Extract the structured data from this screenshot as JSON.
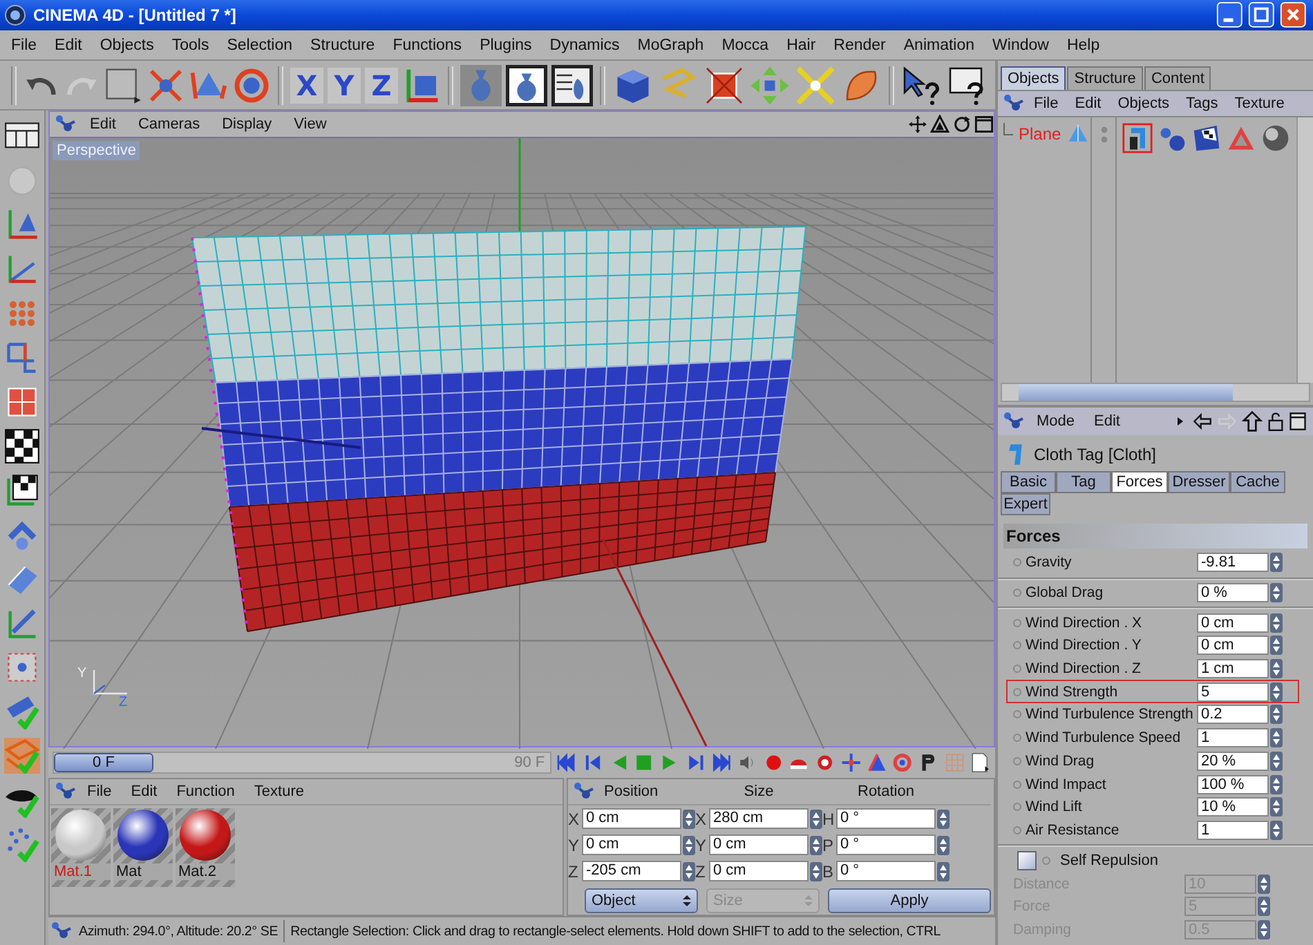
{
  "window": {
    "title": "CINEMA 4D - [Untitled 7 *]"
  },
  "menu_bar": [
    "File",
    "Edit",
    "Objects",
    "Tools",
    "Selection",
    "Structure",
    "Functions",
    "Plugins",
    "Dynamics",
    "MoGraph",
    "Mocca",
    "Hair",
    "Render",
    "Animation",
    "Window",
    "Help"
  ],
  "toolbar": {
    "axis_buttons": [
      "X",
      "Y",
      "Z"
    ]
  },
  "viewport": {
    "menu": [
      "Edit",
      "Cameras",
      "Display",
      "View"
    ],
    "camera_label": "Perspective",
    "axis_labels": [
      "Y",
      "Z"
    ]
  },
  "timeline": {
    "current_frame": "0 F",
    "end_frame": "90 F"
  },
  "material_manager": {
    "menu": [
      "File",
      "Edit",
      "Function",
      "Texture"
    ],
    "materials": [
      {
        "name": "Mat.1",
        "color": "#c8c8c8",
        "selected": true
      },
      {
        "name": "Mat",
        "color": "#2a35b8",
        "selected": false
      },
      {
        "name": "Mat.2",
        "color": "#c41818",
        "selected": false
      }
    ]
  },
  "coordinates": {
    "columns": [
      "Position",
      "Size",
      "Rotation"
    ],
    "rows": [
      {
        "cells": [
          {
            "axis": "X",
            "value": "0 cm"
          },
          {
            "axis": "X",
            "value": "280 cm"
          },
          {
            "axis": "H",
            "value": "0 °"
          }
        ]
      },
      {
        "cells": [
          {
            "axis": "Y",
            "value": "0 cm"
          },
          {
            "axis": "Y",
            "value": "0 cm"
          },
          {
            "axis": "P",
            "value": "0 °"
          }
        ]
      },
      {
        "cells": [
          {
            "axis": "Z",
            "value": "-205 cm"
          },
          {
            "axis": "Z",
            "value": "0 cm"
          },
          {
            "axis": "B",
            "value": "0 °"
          }
        ]
      }
    ],
    "mode_dropdown": {
      "value": "Object",
      "disabled": false
    },
    "size_dropdown": {
      "value": "Size",
      "disabled": true
    },
    "apply": "Apply"
  },
  "status_bar": {
    "view_info": "Azimuth: 294.0°, Altitude: 20.2°  SE",
    "message": "Rectangle Selection: Click and drag to rectangle-select elements. Hold down SHIFT to add to the selection, CTRL"
  },
  "object_manager": {
    "tabs": [
      {
        "label": "Objects",
        "selected": true
      },
      {
        "label": "Structure",
        "selected": false
      },
      {
        "label": "Content",
        "selected": false
      }
    ],
    "menu": [
      "File",
      "Edit",
      "Objects",
      "Tags",
      "Texture"
    ],
    "objects": [
      {
        "name": "Plane",
        "selected": true
      }
    ]
  },
  "attribute_manager": {
    "menu": [
      "Mode",
      "Edit"
    ],
    "title": "Cloth Tag [Cloth]",
    "tabs": [
      {
        "label": "Basic",
        "selected": false
      },
      {
        "label": "Tag",
        "selected": false
      },
      {
        "label": "Forces",
        "selected": true
      },
      {
        "label": "Dresser",
        "selected": false
      },
      {
        "label": "Cache",
        "selected": false
      },
      {
        "label": "Expert",
        "selected": false
      }
    ],
    "section": "Forces",
    "groups": [
      {
        "params": [
          {
            "label": "Gravity",
            "value": "-9.81",
            "highlighted": false
          }
        ]
      },
      {
        "params": [
          {
            "label": "Global Drag",
            "value": "0 %",
            "highlighted": false
          }
        ]
      },
      {
        "params": [
          {
            "label": "Wind Direction . X",
            "value": "0 cm",
            "highlighted": false
          },
          {
            "label": "Wind Direction . Y",
            "value": "0 cm",
            "highlighted": false
          },
          {
            "label": "Wind Direction . Z",
            "value": "1 cm",
            "highlighted": false
          },
          {
            "label": "Wind Strength",
            "value": "5",
            "highlighted": true
          },
          {
            "label": "Wind Turbulence Strength",
            "value": "0.2",
            "highlighted": false
          },
          {
            "label": "Wind Turbulence Speed",
            "value": "1",
            "highlighted": false
          },
          {
            "label": "Wind Drag",
            "value": "20 %",
            "highlighted": false
          },
          {
            "label": "Wind Impact",
            "value": "100 %",
            "highlighted": false
          },
          {
            "label": "Wind Lift",
            "value": "10 %",
            "highlighted": false
          },
          {
            "label": "Air Resistance",
            "value": "1",
            "highlighted": false
          }
        ]
      }
    ],
    "self_repulsion": {
      "label": "Self Repulsion",
      "checked": false,
      "params": [
        {
          "label": "Distance",
          "value": "10",
          "disabled": true
        },
        {
          "label": "Force",
          "value": "5",
          "disabled": true
        },
        {
          "label": "Damping",
          "value": "0.5",
          "disabled": true
        }
      ]
    }
  }
}
